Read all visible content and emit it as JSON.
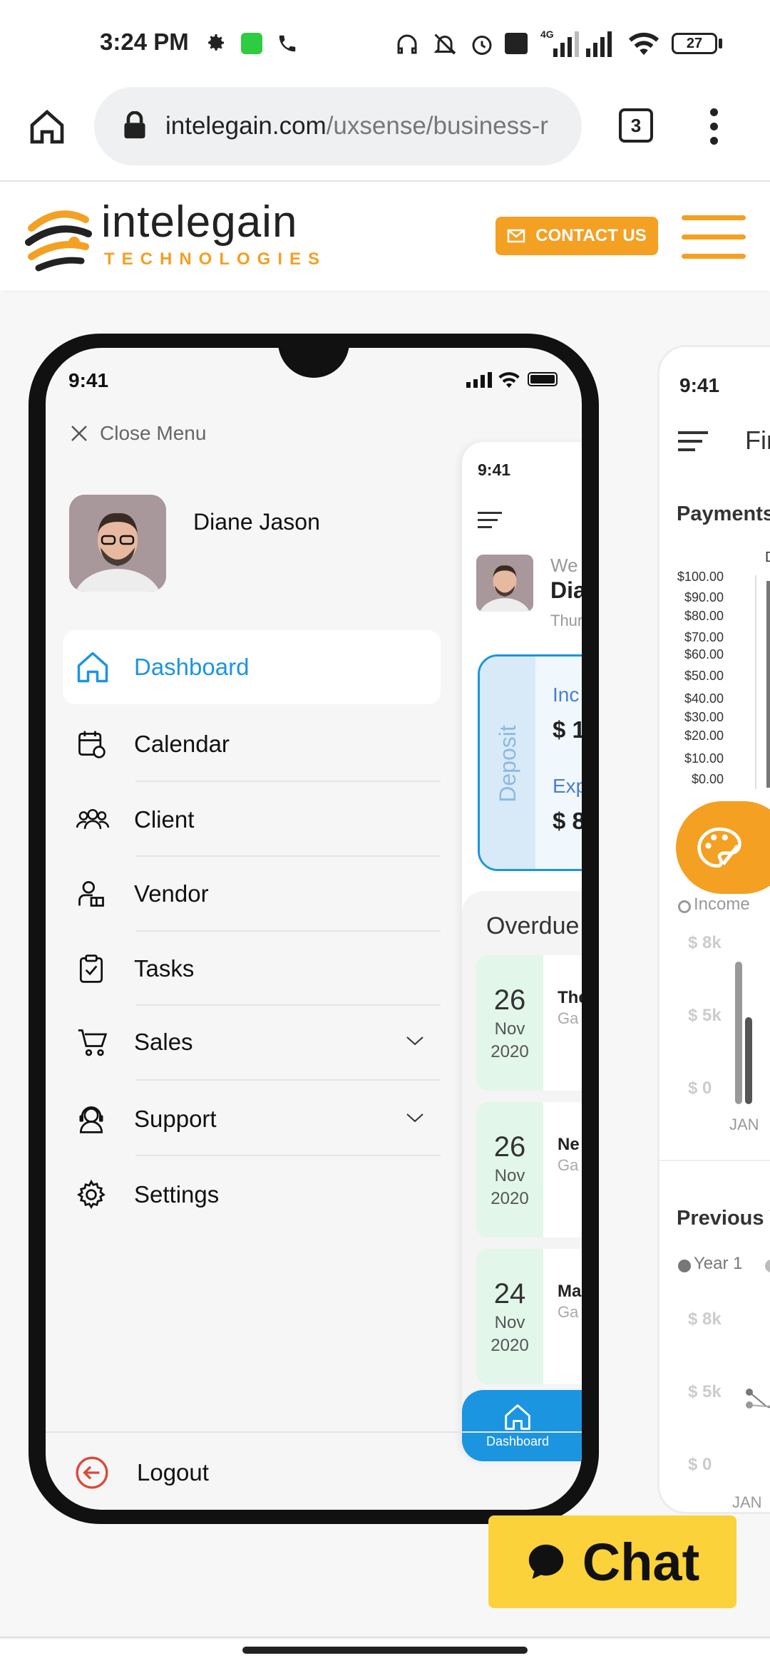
{
  "status_bar": {
    "time": "3:24 PM",
    "battery": "27",
    "net_label": "4G"
  },
  "browser": {
    "url_domain": "intelegain.com",
    "url_path": "/uxsense/business-r",
    "tab_count": "3"
  },
  "site": {
    "brand_name": "intelegain",
    "brand_sub": "TECHNOLOGIES",
    "contact_label": "CONTACT US"
  },
  "phone1": {
    "time": "9:41",
    "close_menu": "Close Menu",
    "user_name": "Diane Jason",
    "menu": [
      {
        "label": "Dashboard",
        "icon": "home-icon",
        "active": true
      },
      {
        "label": "Calendar",
        "icon": "calendar-icon"
      },
      {
        "label": "Client",
        "icon": "users-icon"
      },
      {
        "label": "Vendor",
        "icon": "vendor-icon"
      },
      {
        "label": "Tasks",
        "icon": "clipboard-icon"
      },
      {
        "label": "Sales",
        "icon": "cart-icon",
        "expandable": true
      },
      {
        "label": "Support",
        "icon": "support-icon",
        "expandable": true
      },
      {
        "label": "Settings",
        "icon": "gear-icon"
      }
    ],
    "logout": "Logout"
  },
  "phone1_inner": {
    "time": "9:41",
    "greeting": "We",
    "name_partial": "Dia",
    "date_partial": "Thur",
    "deposit_label": "Deposit",
    "income_label": "Inc",
    "income_value": "$ 1",
    "expense_label": "Exp",
    "expense_value": "$ 8",
    "overdue_title": "Overdue",
    "overdue": [
      {
        "day": "26",
        "month": "Nov",
        "year": "2020",
        "title": "The",
        "sub": "Ga"
      },
      {
        "day": "26",
        "month": "Nov",
        "year": "2020",
        "title": "Ne",
        "sub": "Ga"
      },
      {
        "day": "24",
        "month": "Nov",
        "year": "2020",
        "title": "Ma",
        "sub": "Ga"
      }
    ],
    "nav_dashboard": "Dashboard"
  },
  "phone2": {
    "time": "9:41",
    "title_partial": "Fir",
    "payments_title": "Payments",
    "payments_ticks": [
      "$100.00",
      "$90.00",
      "$80.00",
      "$70.00",
      "$60.00",
      "$50.00",
      "$40.00",
      "$30.00",
      "$20.00",
      "$10.00",
      "$0.00"
    ],
    "payments_d": "D",
    "income_legend": "Income",
    "income_ticks": [
      "$ 8k",
      "$ 5k",
      "$ 0"
    ],
    "income_x": "JAN",
    "previous_title": "Previous Y",
    "year1": "Year 1",
    "prev_ticks": [
      "$ 8k",
      "$ 5k",
      "$ 0"
    ],
    "prev_x": "JAN"
  },
  "chat": {
    "label": "Chat"
  },
  "colors": {
    "accent_orange": "#f4a023",
    "accent_blue": "#1b95e0",
    "chat_yellow": "#fcd23a"
  }
}
